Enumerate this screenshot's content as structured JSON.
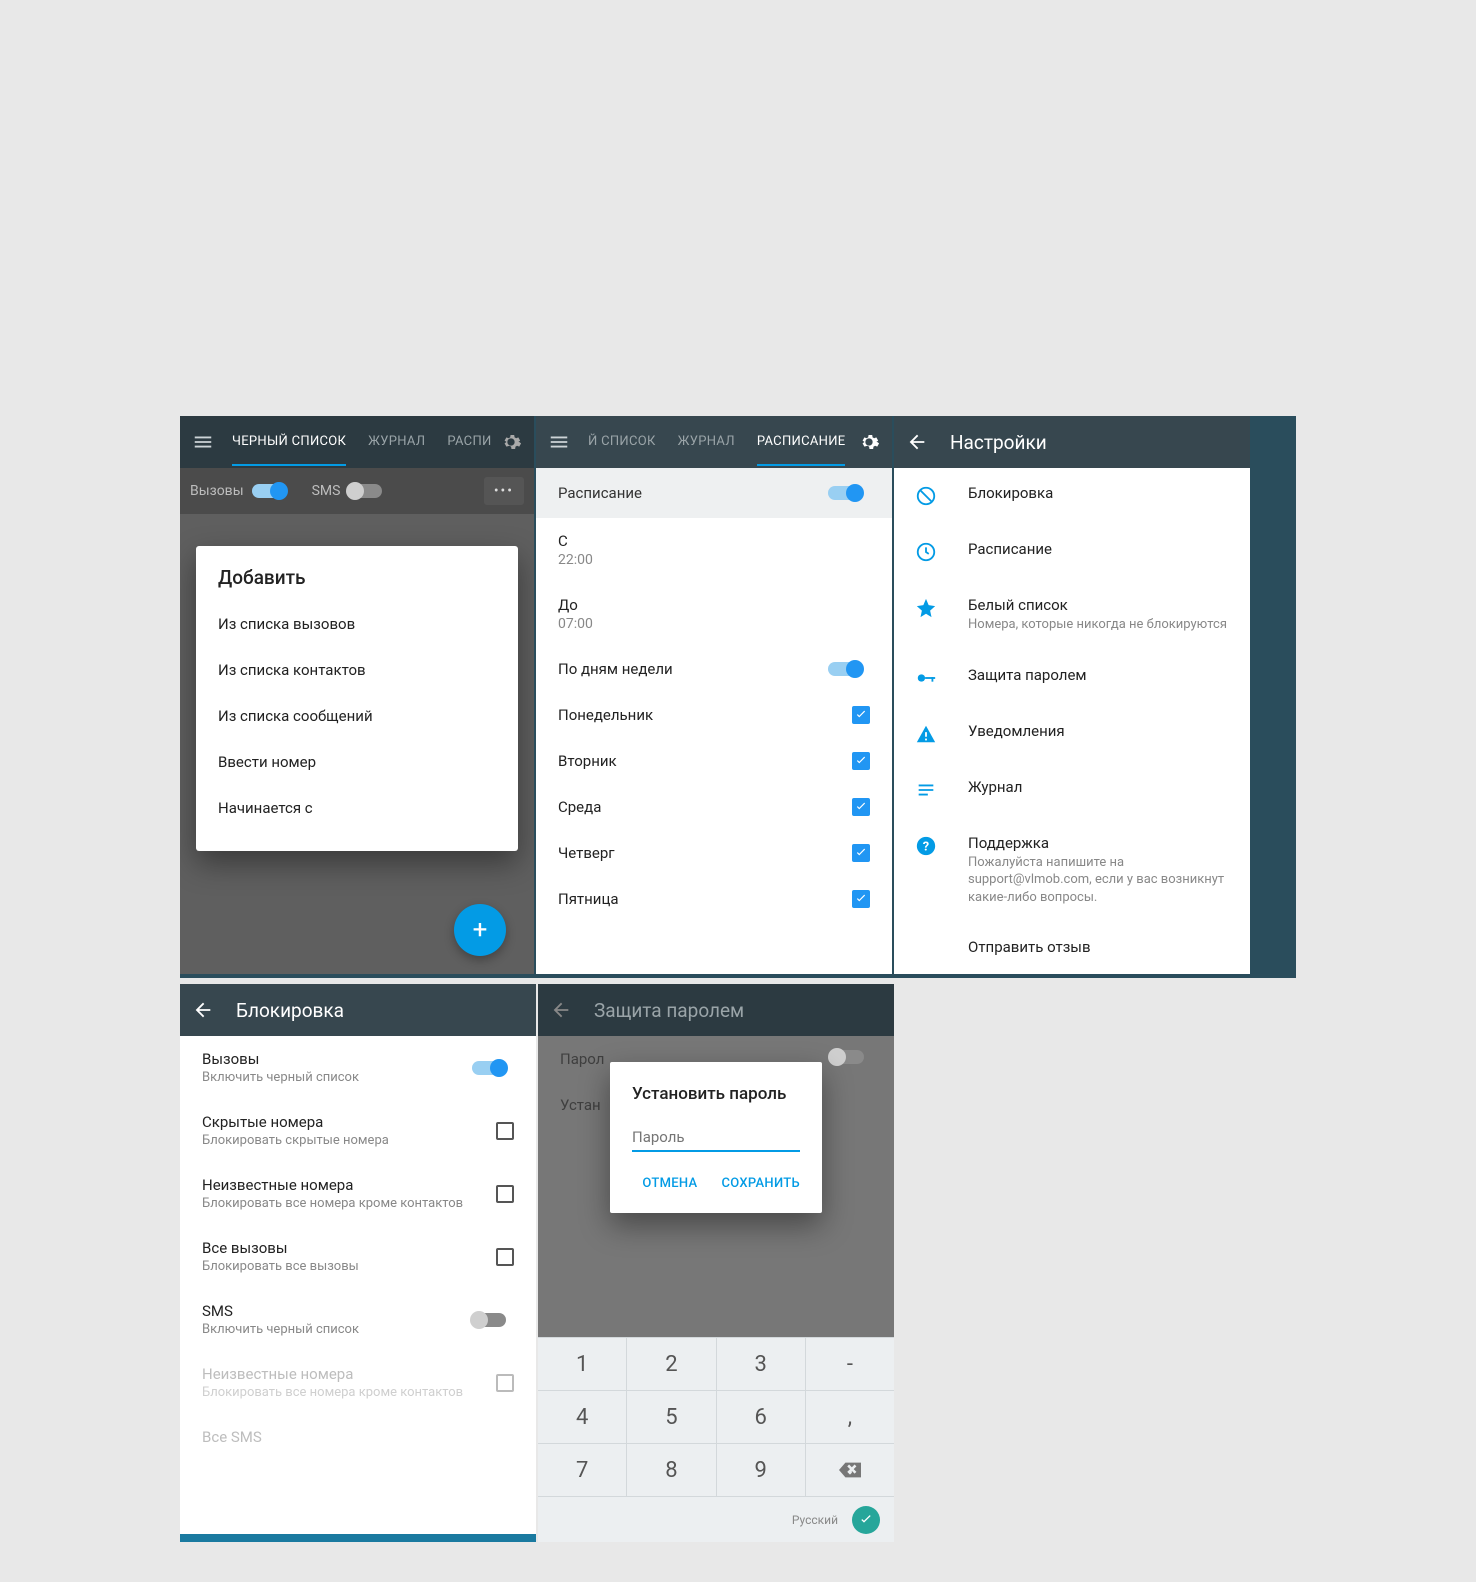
{
  "s1": {
    "tabs": [
      "ЧЕРНЫЙ СПИСОК",
      "ЖУРНАЛ",
      "РАСПИ"
    ],
    "calls": "Вызовы",
    "sms": "SMS",
    "dialog_title": "Добавить",
    "items": [
      "Из списка вызовов",
      "Из списка контактов",
      "Из списка сообщений",
      "Ввести номер",
      "Начинается с"
    ]
  },
  "s2": {
    "tabs": [
      "Й СПИСОК",
      "ЖУРНАЛ",
      "РАСПИСАНИЕ"
    ],
    "head": "Расписание",
    "from_lbl": "С",
    "from_val": "22:00",
    "to_lbl": "До",
    "to_val": "07:00",
    "bydays": "По дням недели",
    "days": [
      "Понедельник",
      "Вторник",
      "Среда",
      "Четверг",
      "Пятница"
    ]
  },
  "s3": {
    "title": "Настройки",
    "items": [
      {
        "t": "Блокировка"
      },
      {
        "t": "Расписание"
      },
      {
        "t": "Белый список",
        "d": "Номера, которые никогда не блокируются"
      },
      {
        "t": "Защита паролем"
      },
      {
        "t": "Уведомления"
      },
      {
        "t": "Журнал"
      },
      {
        "t": "Поддержка",
        "d": "Пожалуйста напишите на support@vlmob.com, если у вас возникнут какие-либо вопросы."
      },
      {
        "t": "Отправить отзыв"
      }
    ]
  },
  "s4": {
    "title": "Блокировка",
    "rows": [
      {
        "t": "Вызовы",
        "d": "Включить черный список",
        "ctrl": "toggle-on"
      },
      {
        "t": "Скрытые номера",
        "d": "Блокировать скрытые номера",
        "ctrl": "check-empty"
      },
      {
        "t": "Неизвестные номера",
        "d": "Блокировать все номера кроме контактов",
        "ctrl": "check-empty"
      },
      {
        "t": "Все вызовы",
        "d": "Блокировать все вызовы",
        "ctrl": "check-empty"
      },
      {
        "t": "SMS",
        "d": "Включить черный список",
        "ctrl": "toggle-off"
      },
      {
        "t": "Неизвестные номера",
        "d": "Блокировать все номера кроме контактов",
        "ctrl": "check-dim",
        "dis": true
      },
      {
        "t": "Все SMS",
        "d": "",
        "dis": true
      }
    ]
  },
  "s5": {
    "title": "Защита паролем",
    "row1": "Парол",
    "row2": "Устан",
    "dlg_title": "Установить пароль",
    "placeholder": "Пароль",
    "cancel": "ОТМЕНА",
    "save": "СОХРАНИТЬ",
    "keys": [
      [
        "1",
        "2",
        "3",
        "-"
      ],
      [
        "4",
        "5",
        "6",
        ","
      ],
      [
        "7",
        "8",
        "9",
        "⌫"
      ]
    ],
    "lang": "Русский"
  }
}
